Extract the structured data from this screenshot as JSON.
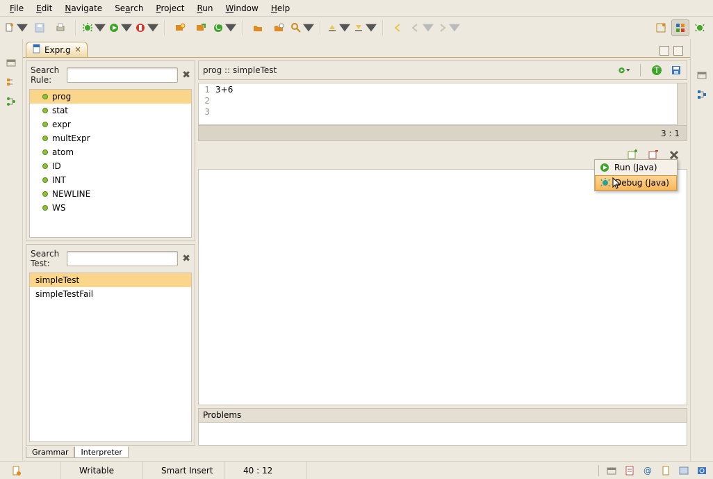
{
  "menu": {
    "items": [
      "File",
      "Edit",
      "Navigate",
      "Search",
      "Project",
      "Run",
      "Window",
      "Help"
    ]
  },
  "tab": {
    "label": "Expr.g"
  },
  "search": {
    "rule_label": "Search Rule:",
    "test_label": "Search Test:"
  },
  "rules": [
    "prog",
    "stat",
    "expr",
    "multExpr",
    "atom",
    "ID",
    "INT",
    "NEWLINE",
    "WS"
  ],
  "rules_selected": "prog",
  "tests": [
    "simpleTest",
    "simpleTestFail"
  ],
  "tests_selected": "simpleTest",
  "breadcrumb": "prog :: simpleTest",
  "code": {
    "lines": [
      "3+6",
      "",
      ""
    ],
    "linenos": [
      "1",
      "2",
      "3"
    ],
    "cursor_pos": "3 : 1"
  },
  "problems": {
    "title": "Problems"
  },
  "bottom_tabs": {
    "grammar": "Grammar",
    "interpreter": "Interpreter"
  },
  "status": {
    "writable": "Writable",
    "insert": "Smart Insert",
    "pos": "40 : 12"
  },
  "run_popup": {
    "run": "Run (Java)",
    "debug": "Debug (Java)"
  }
}
